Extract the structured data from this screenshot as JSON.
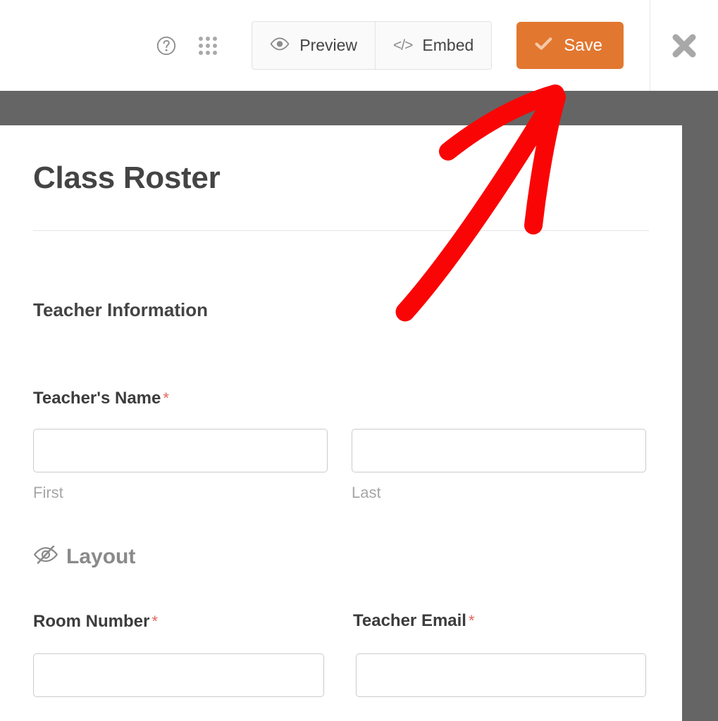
{
  "toolbar": {
    "help_icon": "help-circle-icon",
    "grid_icon": "app-grid-icon",
    "preview_label": "Preview",
    "preview_icon": "eye-icon",
    "embed_label": "Embed",
    "embed_icon": "code-icon",
    "embed_glyph": "</>",
    "save_label": "Save",
    "save_icon": "check-icon",
    "close_icon": "close-x-icon",
    "save_color": "#e27730"
  },
  "form": {
    "title": "Class Roster",
    "section_heading": "Teacher Information",
    "required_marker": "*",
    "fields": [
      {
        "label": "Teacher's Name",
        "required": true,
        "value": "",
        "placeholder": "",
        "sub_label": "First"
      },
      {
        "label": "",
        "required": false,
        "value": "",
        "placeholder": "",
        "sub_label": "Last"
      },
      {
        "label": "Room Number",
        "required": true,
        "value": "",
        "placeholder": "",
        "sub_label": ""
      },
      {
        "label": "Teacher Email",
        "required": true,
        "value": "",
        "placeholder": "",
        "sub_label": ""
      }
    ],
    "layout_section": {
      "label": "Layout",
      "icon": "eye-slash-icon"
    }
  },
  "annotation": {
    "type": "arrow",
    "color": "#fa0505",
    "points_to": "save-button"
  },
  "colors": {
    "backdrop": "#656565",
    "panel": "#ffffff",
    "accent": "#e27730",
    "required": "#e2665a",
    "text": "#444444",
    "muted": "#a6a6a6"
  }
}
